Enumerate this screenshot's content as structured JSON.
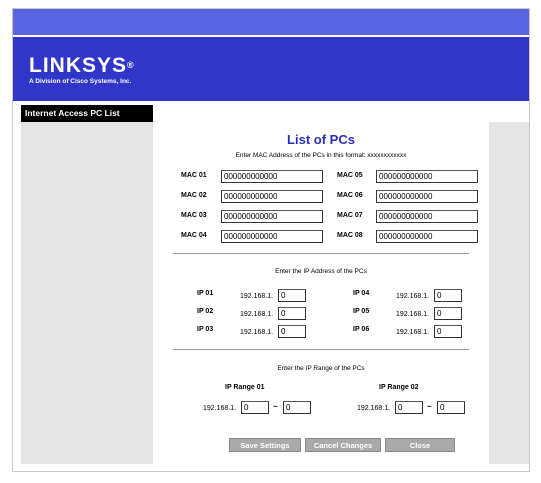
{
  "brand": {
    "logo_text": "LINKSYS",
    "logo_mark": "®",
    "tagline": "A Division of Cisco Systems, Inc."
  },
  "sidebar": {
    "title": "Internet Access PC List"
  },
  "main": {
    "title": "List of PCs",
    "mac_instruction": "Enter MAC Address of the PCs in this format: xxxxxxxxxxxx",
    "macs": [
      {
        "label": "MAC 01",
        "value": "000000000000"
      },
      {
        "label": "MAC 02",
        "value": "000000000000"
      },
      {
        "label": "MAC 03",
        "value": "000000000000"
      },
      {
        "label": "MAC 04",
        "value": "000000000000"
      },
      {
        "label": "MAC 05",
        "value": "000000000000"
      },
      {
        "label": "MAC 06",
        "value": "000000000000"
      },
      {
        "label": "MAC 07",
        "value": "000000000000"
      },
      {
        "label": "MAC 08",
        "value": "000000000000"
      }
    ],
    "ip_instruction": "Enter the IP Address of the PCs",
    "ip_prefix": "192.168.1.",
    "ips": [
      {
        "label": "IP 01",
        "value": "0"
      },
      {
        "label": "IP 02",
        "value": "0"
      },
      {
        "label": "IP 03",
        "value": "0"
      },
      {
        "label": "IP 04",
        "value": "0"
      },
      {
        "label": "IP 05",
        "value": "0"
      },
      {
        "label": "IP 06",
        "value": "0"
      }
    ],
    "range_instruction": "Enter the IP Range of the PCs",
    "ranges": [
      {
        "label": "IP Range 01",
        "start": "0",
        "end": "0"
      },
      {
        "label": "IP Range 02",
        "start": "0",
        "end": "0"
      }
    ],
    "range_separator": "~"
  },
  "buttons": {
    "save": "Save Settings",
    "cancel": "Cancel Changes",
    "close": "Close"
  }
}
